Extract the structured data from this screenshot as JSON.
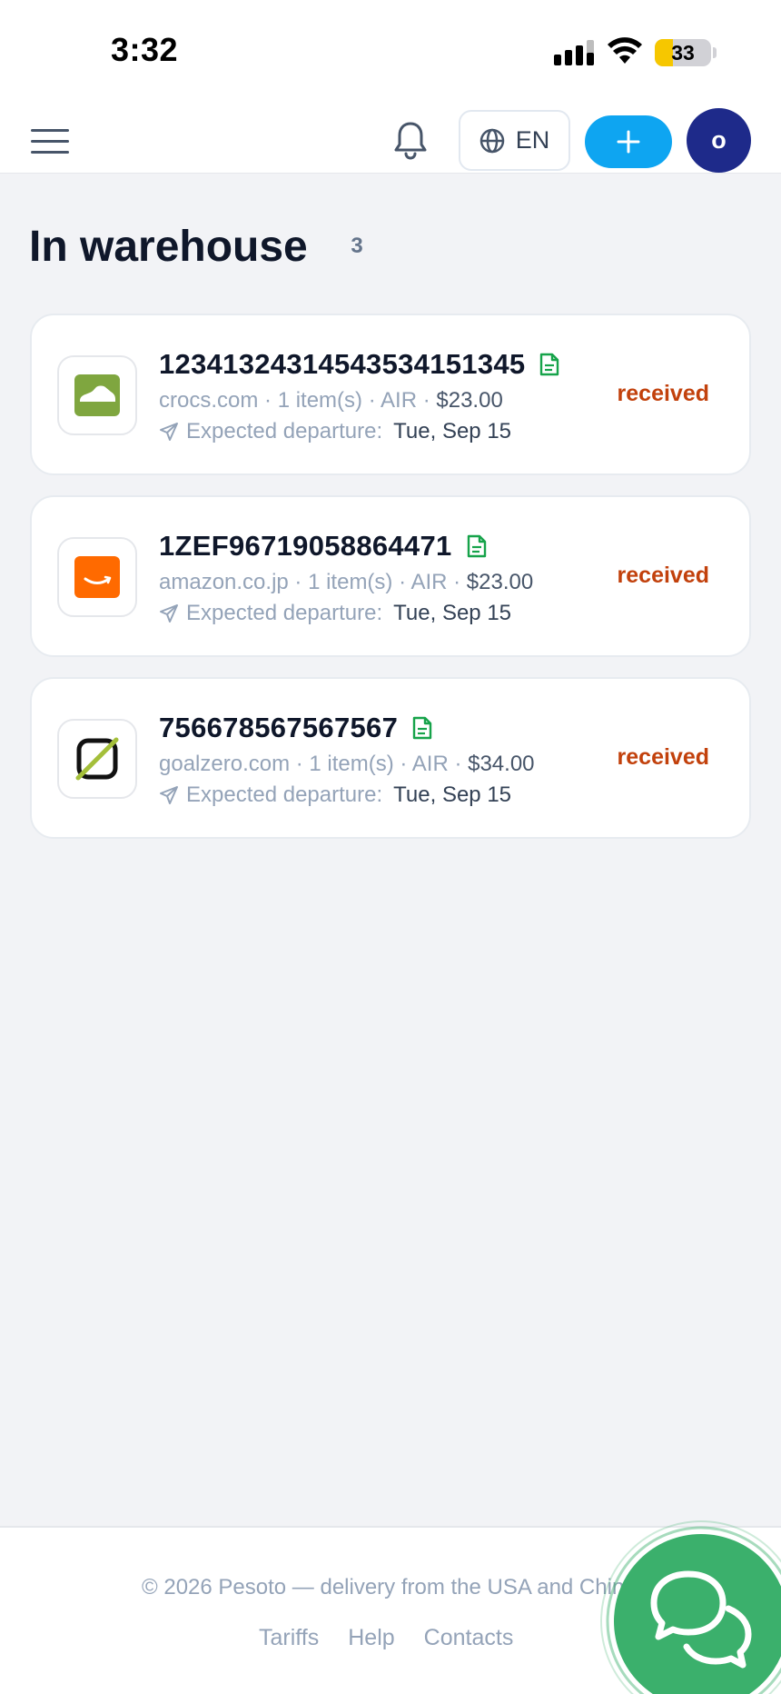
{
  "status_bar": {
    "time": "3:32",
    "battery": "33",
    "battery_fraction": 0.33,
    "icons": [
      "cellular-signal-icon",
      "wifi-icon",
      "battery-icon"
    ]
  },
  "header": {
    "menu_icon": "hamburger-menu-icon",
    "notification_icon": "bell-icon",
    "language_icon": "globe-icon",
    "language": "EN",
    "add_icon": "plus-icon",
    "avatar_initial": "o",
    "colors": {
      "add_button": "#0ea5f1",
      "avatar": "#1e2a8a"
    }
  },
  "page": {
    "title": "In warehouse",
    "count": "3"
  },
  "packages": [
    {
      "tracking": "12341324314543534151345",
      "store": "crocs.com",
      "items": "1 item(s)",
      "method": "AIR",
      "price": "$23.00",
      "departure_label": "Expected departure:",
      "departure_date": "Tue, Sep 15",
      "status": "received",
      "logo": "crocs-logo"
    },
    {
      "tracking": "1ZEF96719058864471",
      "store": "amazon.co.jp",
      "items": "1 item(s)",
      "method": "AIR",
      "price": "$23.00",
      "departure_label": "Expected departure:",
      "departure_date": "Tue, Sep 15",
      "status": "received",
      "logo": "amazon-logo"
    },
    {
      "tracking": "756678567567567",
      "store": "goalzero.com",
      "items": "1 item(s)",
      "method": "AIR",
      "price": "$34.00",
      "departure_label": "Expected departure:",
      "departure_date": "Tue, Sep 15",
      "status": "received",
      "logo": "goalzero-logo"
    }
  ],
  "card_icons": {
    "document": "document-icon",
    "departure": "send-icon"
  },
  "status_color": "#c2410c",
  "footer": {
    "copyright": "© 2026 Pesoto — delivery from the USA and China",
    "links": [
      "Tariffs",
      "Help",
      "Contacts"
    ]
  },
  "chat": {
    "icon": "chat-bubbles-icon",
    "color": "#3bb06c"
  }
}
